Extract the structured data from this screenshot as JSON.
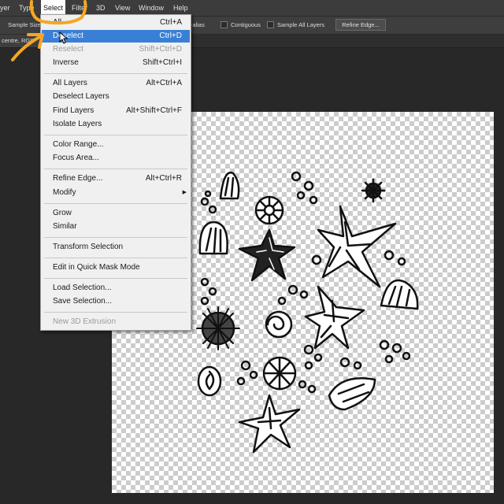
{
  "menubar": {
    "items": [
      "yer",
      "Type",
      "Select",
      "Filter",
      "3D",
      "View",
      "Window",
      "Help"
    ]
  },
  "options_bar": {
    "sample_size_label": "Sample Size:",
    "anti_alias": "Anti-alias",
    "contiguous": "Contiguous",
    "sample_all_layers": "Sample All Layers",
    "refine_edge_button": "Refine Edge..."
  },
  "document_tab": {
    "label": "centre, RGB"
  },
  "select_menu": {
    "items": [
      {
        "label": "All",
        "shortcut": "Ctrl+A",
        "state": "enabled"
      },
      {
        "label": "Deselect",
        "shortcut": "Ctrl+D",
        "state": "highlighted"
      },
      {
        "label": "Reselect",
        "shortcut": "Shift+Ctrl+D",
        "state": "disabled"
      },
      {
        "label": "Inverse",
        "shortcut": "Shift+Ctrl+I",
        "state": "enabled"
      },
      {
        "label": "All Layers",
        "shortcut": "Alt+Ctrl+A",
        "state": "enabled"
      },
      {
        "label": "Deselect Layers",
        "shortcut": "",
        "state": "enabled"
      },
      {
        "label": "Find Layers",
        "shortcut": "Alt+Shift+Ctrl+F",
        "state": "enabled"
      },
      {
        "label": "Isolate Layers",
        "shortcut": "",
        "state": "enabled"
      },
      {
        "label": "Color Range...",
        "shortcut": "",
        "state": "enabled"
      },
      {
        "label": "Focus Area...",
        "shortcut": "",
        "state": "enabled"
      },
      {
        "label": "Refine Edge...",
        "shortcut": "Alt+Ctrl+R",
        "state": "enabled"
      },
      {
        "label": "Modify",
        "shortcut": "",
        "state": "submenu"
      },
      {
        "label": "Grow",
        "shortcut": "",
        "state": "enabled"
      },
      {
        "label": "Similar",
        "shortcut": "",
        "state": "enabled"
      },
      {
        "label": "Transform Selection",
        "shortcut": "",
        "state": "enabled"
      },
      {
        "label": "Edit in Quick Mask Mode",
        "shortcut": "",
        "state": "enabled"
      },
      {
        "label": "Load Selection...",
        "shortcut": "",
        "state": "enabled"
      },
      {
        "label": "Save Selection...",
        "shortcut": "",
        "state": "enabled"
      },
      {
        "label": "New 3D Extrusion",
        "shortcut": "",
        "state": "disabled"
      }
    ]
  },
  "colors": {
    "highlight": "#3a7fd6",
    "annotation": "#f5a623"
  },
  "icons": [
    "checkerboard-transparency",
    "submenu-arrow-icon",
    "mouse-cursor-icon",
    "annotation-arrow-icon",
    "annotation-circle-icon"
  ]
}
